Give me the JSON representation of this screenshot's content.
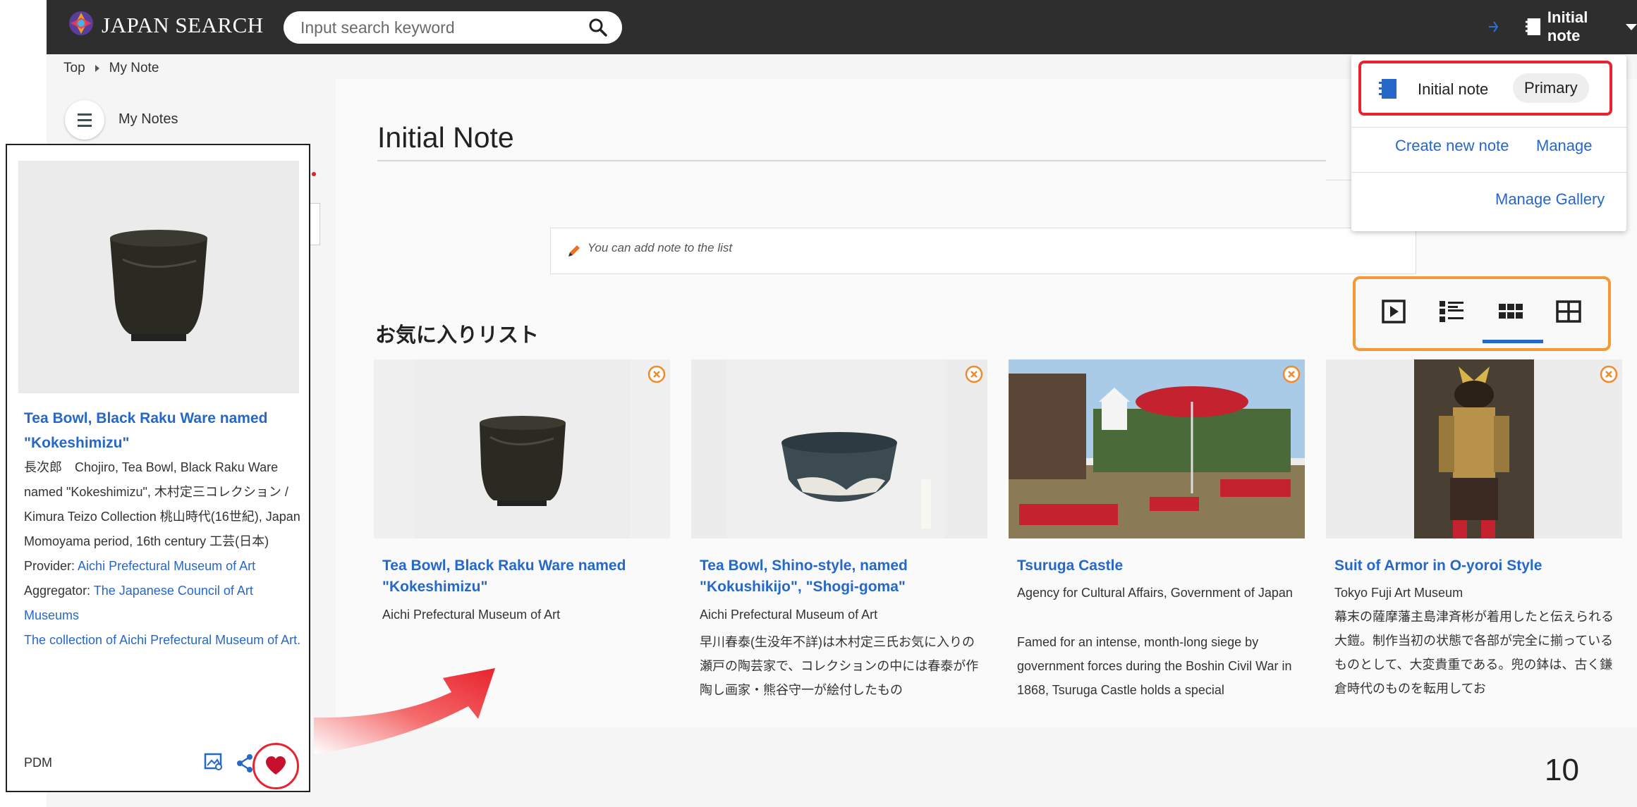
{
  "header": {
    "brand": "JAPAN SEARCH",
    "search_placeholder": "Input search keyword",
    "note_menu_label": "Initial note"
  },
  "breadcrumb": {
    "home": "Top",
    "current": "My Note"
  },
  "sidebar": {
    "my_notes_label": "My Notes"
  },
  "note": {
    "title": "Initial Note",
    "note_placeholder": "You can add note to the list",
    "list_heading": "お気に入りリスト"
  },
  "dropdown": {
    "note_name": "Initial note",
    "primary_chip": "Primary",
    "create_label": "Create new note",
    "manage_label": "Manage",
    "gallery_label": "Manage Gallery"
  },
  "views": {
    "items": [
      "slideshow-view",
      "list-view",
      "grid-view",
      "table-view"
    ],
    "active": "grid-view"
  },
  "cards": [
    {
      "title": "Tea Bowl, Black Raku Ware named \"Kokeshimizu\"",
      "org": "Aichi Prefectural Museum of Art",
      "desc": ""
    },
    {
      "title": "Tea Bowl, Shino-style, named \"Kokushikijo\", \"Shogi-goma\"",
      "org": "Aichi Prefectural Museum of Art",
      "desc": "早川春泰(生没年不詳)は木村定三氏お気に入りの瀬戸の陶芸家で、コレクションの中には春泰が作陶し画家・熊谷守一が絵付したもの"
    },
    {
      "title": "Tsuruga Castle",
      "org": "Agency for Cultural Affairs, Government of Japan",
      "desc": "Famed for an intense, month-long siege by government forces during the Boshin Civil War in 1868, Tsuruga Castle holds a special"
    },
    {
      "title": "Suit of Armor in O-yoroi Style",
      "org": "Tokyo Fuji Art Museum",
      "desc": "幕末の薩摩藩主島津斉彬が着用したと伝えられる大鎧。制作当初の状態で各部が完全に揃っているものとして、大変貴重である。兜の鉢は、古く鎌倉時代のものを転用してお"
    }
  ],
  "callout": {
    "title": "Tea Bowl, Black Raku Ware named \"Kokeshimizu\"",
    "body": "長次郎　Chojiro, Tea Bowl, Black Raku Ware named \"Kokeshimizu\", 木村定三コレクション / Kimura Teizo Collection 桃山時代(16世紀), Japan Momoyama period, 16th century 工芸(日本)",
    "provider_label": "Provider: ",
    "provider": "Aichi Prefectural Museum of Art",
    "aggregator_label": "Aggregator: ",
    "aggregator": "The Japanese Council of Art Museums",
    "collection_link": "The collection of Aichi Prefectural Museum of Art.",
    "license": "PDM"
  },
  "page_number": "10",
  "colors": {
    "accent": "#2668c9",
    "highlight_red": "#e8232e",
    "highlight_orange": "#f59a33",
    "topbar": "#2e2e2e"
  }
}
